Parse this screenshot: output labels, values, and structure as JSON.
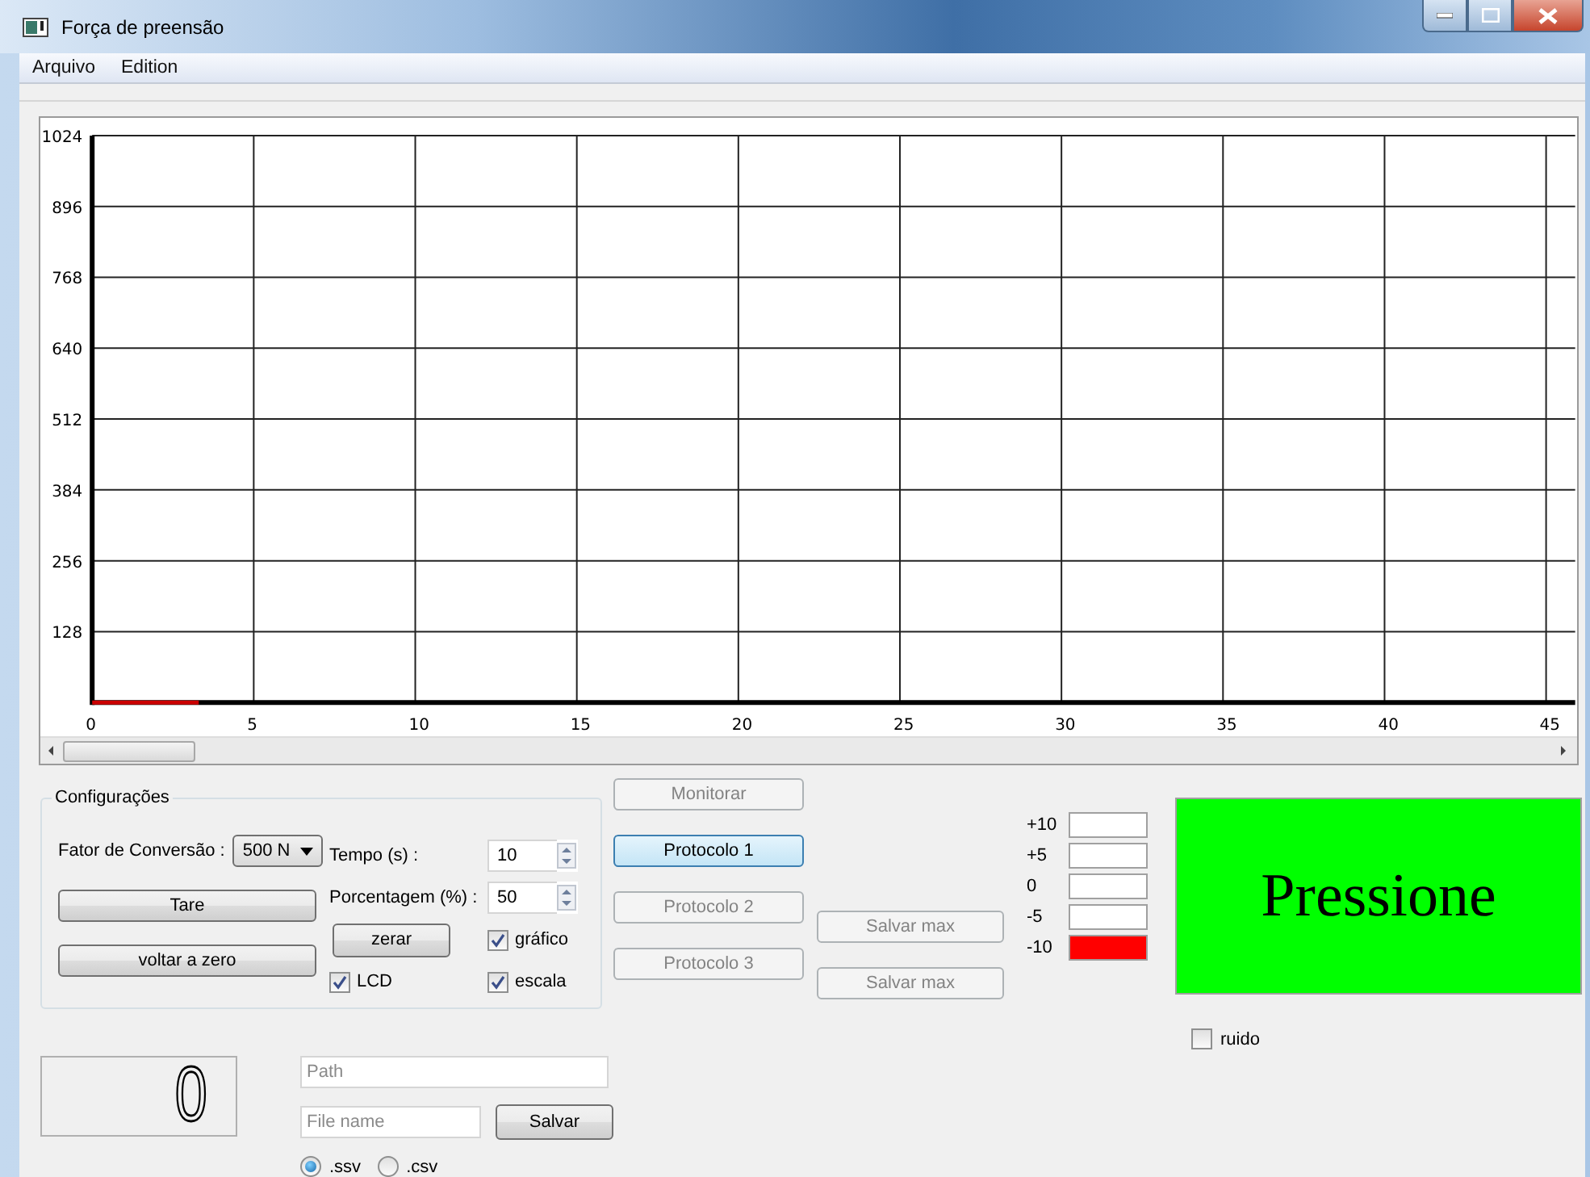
{
  "window": {
    "title": "Força de preensão"
  },
  "menu": [
    {
      "label": "Arquivo"
    },
    {
      "label": "Edition"
    }
  ],
  "chart": {
    "chart_data": {
      "type": "line",
      "grid": true,
      "x": [
        0,
        3.3
      ],
      "series": [
        {
          "color": "#cc0000",
          "values": [
            0,
            0
          ]
        }
      ],
      "xlim": [
        0,
        45.9
      ],
      "ylim": [
        0,
        1024
      ],
      "xticks": [
        0,
        5,
        10,
        15,
        20,
        25,
        30,
        35,
        40,
        45
      ],
      "yticks": [
        128,
        256,
        384,
        512,
        640,
        768,
        896,
        1024
      ]
    }
  },
  "configuracoes": {
    "title": "Configurações",
    "conversion": {
      "label": "Fator de Conversão :",
      "value": "500 N"
    },
    "tare": "Tare",
    "voltar": "voltar a zero",
    "tempo": {
      "label": "Tempo (s) :",
      "value": "10"
    },
    "porcentagem": {
      "label": "Porcentagem (%) :",
      "value": "50"
    },
    "zerar": "zerar",
    "checkboxes": [
      {
        "label": "gráfico",
        "checked": true
      },
      {
        "label": "LCD",
        "checked": true
      },
      {
        "label": "escala",
        "checked": true
      }
    ]
  },
  "protocol_buttons": [
    {
      "label": "Monitorar",
      "disabled": true,
      "selected": false
    },
    {
      "label": "Protocolo 1",
      "disabled": false,
      "selected": true
    },
    {
      "label": "Protocolo 2",
      "disabled": true,
      "selected": false
    },
    {
      "label": "Protocolo 3",
      "disabled": true,
      "selected": false
    }
  ],
  "save_max_buttons": [
    {
      "label": "Salvar max",
      "disabled": true
    },
    {
      "label": "Salvar max",
      "disabled": true
    }
  ],
  "levels": [
    {
      "label": "+10",
      "color": "#ffffff"
    },
    {
      "label": "+5",
      "color": "#ffffff"
    },
    {
      "label": "0",
      "color": "#ffffff"
    },
    {
      "label": "-5",
      "color": "#ffffff"
    },
    {
      "label": "-10",
      "color": "#ff0000"
    }
  ],
  "indicator": {
    "text": "Pressione",
    "color": "#00ff00"
  },
  "ruido": {
    "label": "ruido",
    "checked": false
  },
  "lcd": {
    "value": "0"
  },
  "path": {
    "placeholder": "Path"
  },
  "file_name": {
    "placeholder": "File name"
  },
  "save_button": "Salvar",
  "formats": [
    {
      "label": ".ssv",
      "selected": true
    },
    {
      "label": ".csv",
      "selected": false
    }
  ]
}
